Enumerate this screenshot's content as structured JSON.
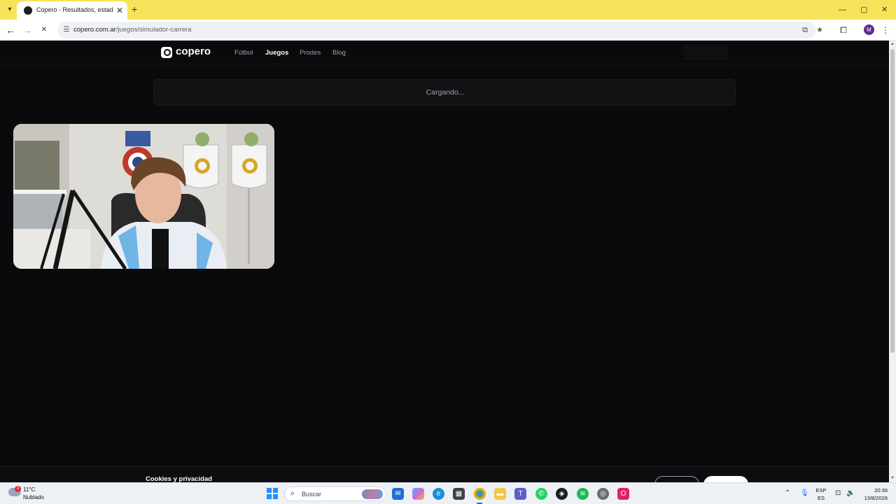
{
  "browser": {
    "tab_title": "Copero - Resultados, estadísticas",
    "new_tab_glyph": "+",
    "tab_close_glyph": "✕",
    "url_host": "copero.com.ar",
    "url_path": "/juegos/simulador-carrera",
    "profile_initial": "M",
    "window_controls": {
      "minimize": "—",
      "maximize": "▢",
      "close": "✕"
    },
    "nav": {
      "back": "←",
      "forward": "→",
      "stop": "✕"
    }
  },
  "site": {
    "logo_text": "copero",
    "nav": [
      {
        "label": "Fútbol",
        "active": false
      },
      {
        "label": "Juegos",
        "active": true
      },
      {
        "label": "Prodes",
        "active": false
      },
      {
        "label": "Blog",
        "active": false
      }
    ],
    "loading_text": "Cargando...",
    "cookie_banner_title": "Cookies y privacidad"
  },
  "taskbar": {
    "weather_temp": "11°C",
    "weather_desc": "Nublado",
    "weather_badge": "3",
    "search_placeholder": "Buscar",
    "language_top": "ESP",
    "language_bottom": "ES",
    "time": "20:36",
    "date": "13/8/2026"
  },
  "colors": {
    "tabbar": "#f6e35a",
    "page_bg": "#0a0a0c",
    "accent": "#1a73e8"
  },
  "icons": {
    "tab_favicon": "copero-favicon",
    "site_info": "tune-icon",
    "install": "install-app-icon",
    "bookmark": "star-icon",
    "extensions": "puzzle-icon",
    "menu": "kebab-menu-icon"
  }
}
